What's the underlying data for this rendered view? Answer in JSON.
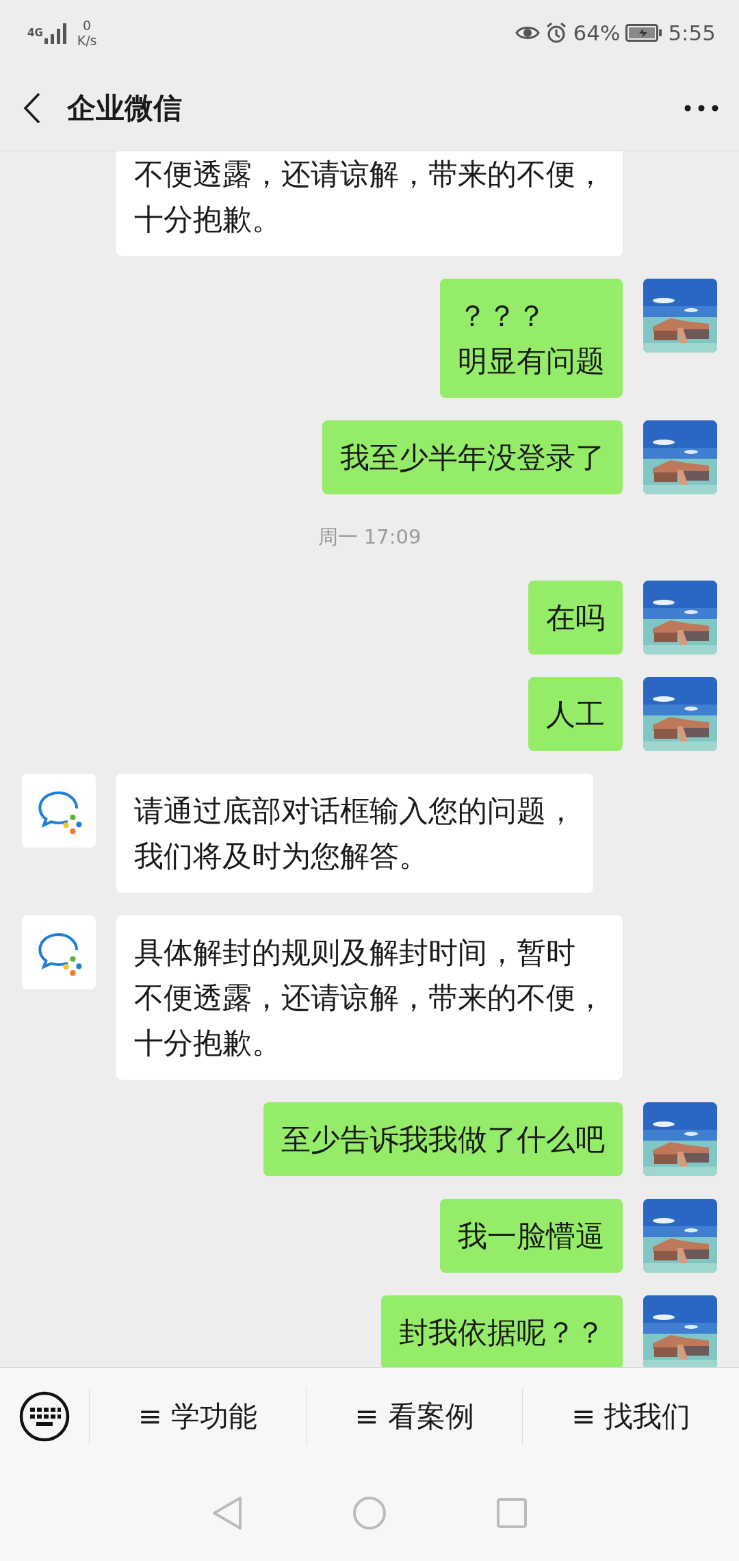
{
  "status_bar": {
    "network": "4G",
    "speed_value": "0",
    "speed_unit": "K/s",
    "battery_percent": "64%",
    "time": "5:55"
  },
  "header": {
    "title": "企业微信"
  },
  "messages": [
    {
      "kind": "incoming",
      "cut": true,
      "lines": [
        "不便透露，还请谅解，带来的不便，",
        "十分抱歉。"
      ]
    },
    {
      "kind": "outgoing",
      "lines": [
        "？？？",
        "明显有问题"
      ]
    },
    {
      "kind": "outgoing",
      "text": "我至少半年没登录了"
    },
    {
      "kind": "time",
      "text": "周一 17:09"
    },
    {
      "kind": "outgoing",
      "text": "在吗"
    },
    {
      "kind": "outgoing",
      "text": "人工"
    },
    {
      "kind": "incoming",
      "lines": [
        "请通过底部对话框输入您的问题，",
        "我们将及时为您解答。"
      ]
    },
    {
      "kind": "incoming",
      "lines": [
        "具体解封的规则及解封时间，暂时",
        "不便透露，还请谅解，带来的不便，",
        "十分抱歉。"
      ]
    },
    {
      "kind": "outgoing",
      "text": "至少告诉我我做了什么吧"
    },
    {
      "kind": "outgoing",
      "text": "我一脸懵逼"
    },
    {
      "kind": "outgoing",
      "text": "封我依据呢？？"
    }
  ],
  "menu": [
    "≡ 学功能",
    "≡ 看案例",
    "≡ 找我们"
  ]
}
